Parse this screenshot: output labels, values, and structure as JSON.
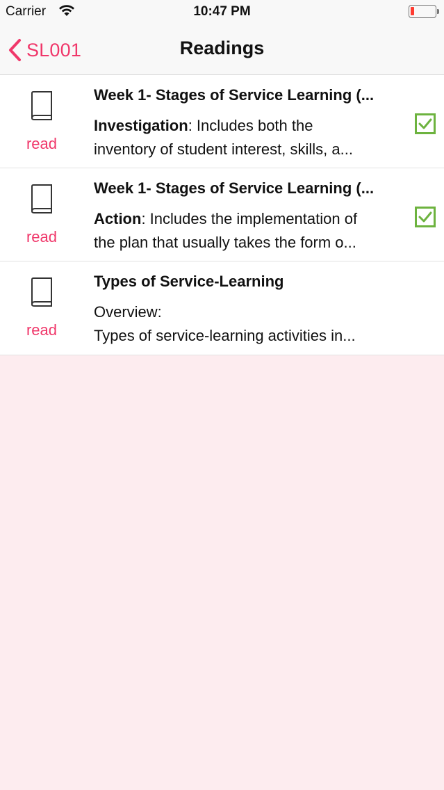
{
  "status_bar": {
    "carrier": "Carrier",
    "time": "10:47 PM"
  },
  "nav": {
    "back_label": "SL001",
    "title": "Readings"
  },
  "colors": {
    "accent": "#f0376a",
    "check": "#6db33f",
    "background": "#fdecef"
  },
  "readings": [
    {
      "icon": "book-icon",
      "status_label": "read",
      "title": "Week 1- Stages of Service Learning (...",
      "line1_bold": "Investigation",
      "line1_rest": ": Includes both the",
      "line2": "inventory of student interest, skills, a...",
      "checked": true
    },
    {
      "icon": "book-icon",
      "status_label": "read",
      "title": "Week 1- Stages of Service Learning (...",
      "line1_bold": "Action",
      "line1_rest": ": Includes the implementation of",
      "line2": "the plan that usually takes the form o...",
      "checked": true
    },
    {
      "icon": "book-icon",
      "status_label": "read",
      "title": "Types of Service-Learning",
      "line1_bold": "",
      "line1_rest": "Overview:",
      "line2": "Types of service-learning activities in...",
      "checked": false
    }
  ]
}
